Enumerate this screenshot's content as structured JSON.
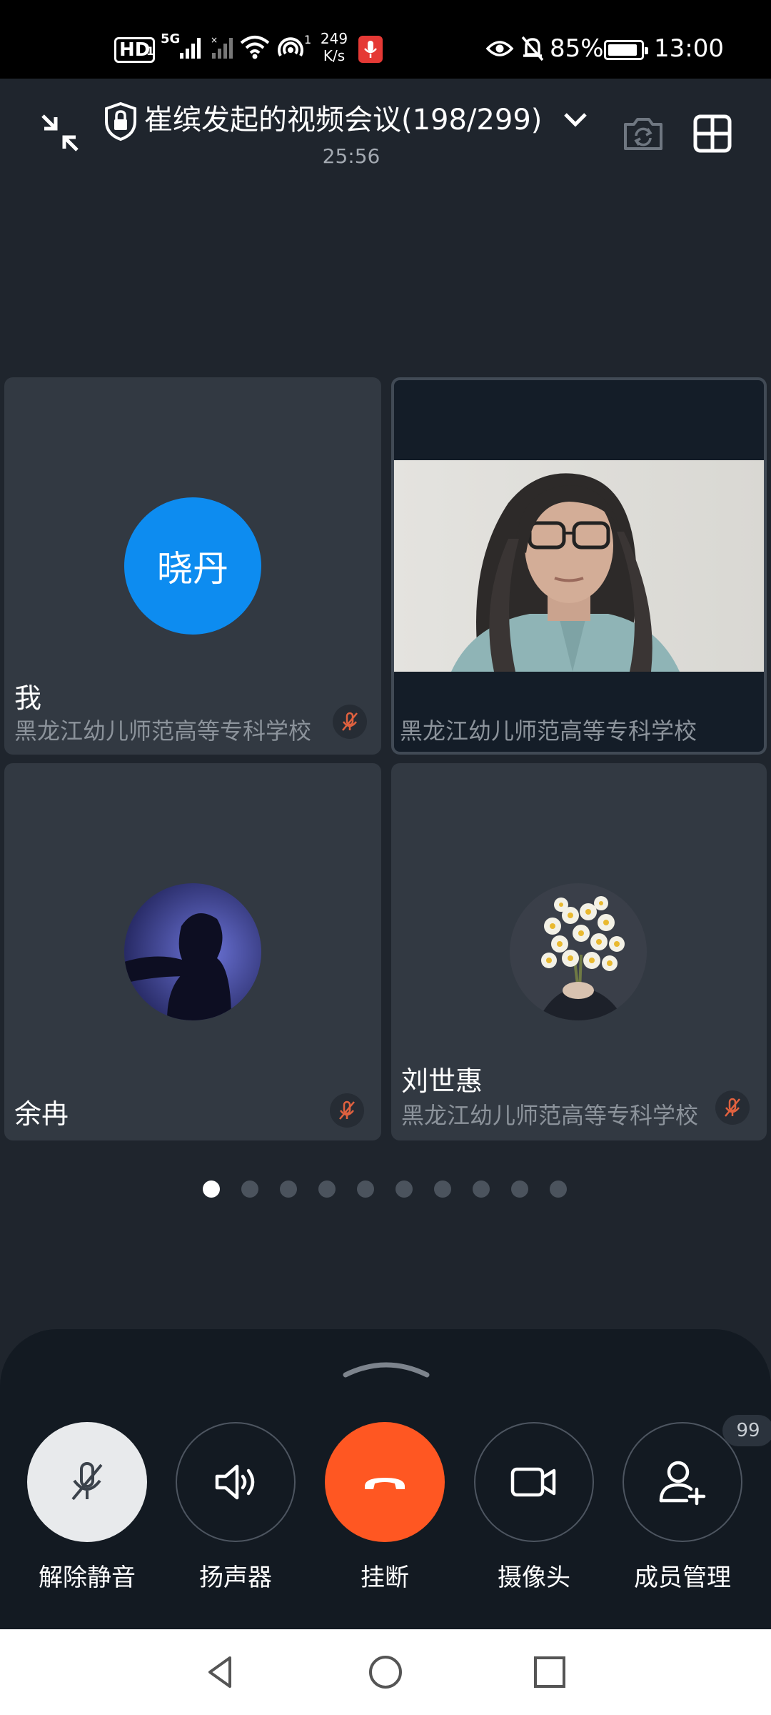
{
  "status_bar": {
    "hd": "HD",
    "sim_index": "1",
    "network": "5G",
    "speed_value": "249",
    "speed_unit": "K/s",
    "wifi_index": "1",
    "battery": "85%",
    "time": "13:00"
  },
  "header": {
    "title": "崔缤发起的视频会议(198/299)",
    "timer": "25:56"
  },
  "participants": [
    {
      "name": "我",
      "avatar_text": "晓丹",
      "org": "黑龙江幼儿师范高等专科学校",
      "muted": true
    },
    {
      "name": "",
      "org": "黑龙江幼儿师范高等专科学校",
      "video": true,
      "muted": false
    },
    {
      "name": "余冉",
      "org": "",
      "muted": true
    },
    {
      "name": "刘世惠",
      "org": "黑龙江幼儿师范高等专科学校",
      "muted": true
    }
  ],
  "pagination": {
    "pages": 10,
    "current": 1
  },
  "controls": {
    "unmute_label": "解除静音",
    "speaker_label": "扬声器",
    "hangup_label": "挂断",
    "camera_label": "摄像头",
    "members_label": "成员管理",
    "members_badge": "99"
  },
  "colors": {
    "background": "#1f252d",
    "avatar_blue": "#0d8cf0",
    "hangup_orange": "#ff5722",
    "mute_red": "#e0613f"
  },
  "icons": [
    "collapse-icon",
    "lock-icon",
    "chevron-down-icon",
    "switch-camera-icon",
    "grid-layout-icon",
    "mic-off-icon",
    "speaker-icon",
    "phone-hangup-icon",
    "video-camera-icon",
    "add-member-icon",
    "nav-back-icon",
    "nav-home-icon",
    "nav-recent-icon"
  ]
}
